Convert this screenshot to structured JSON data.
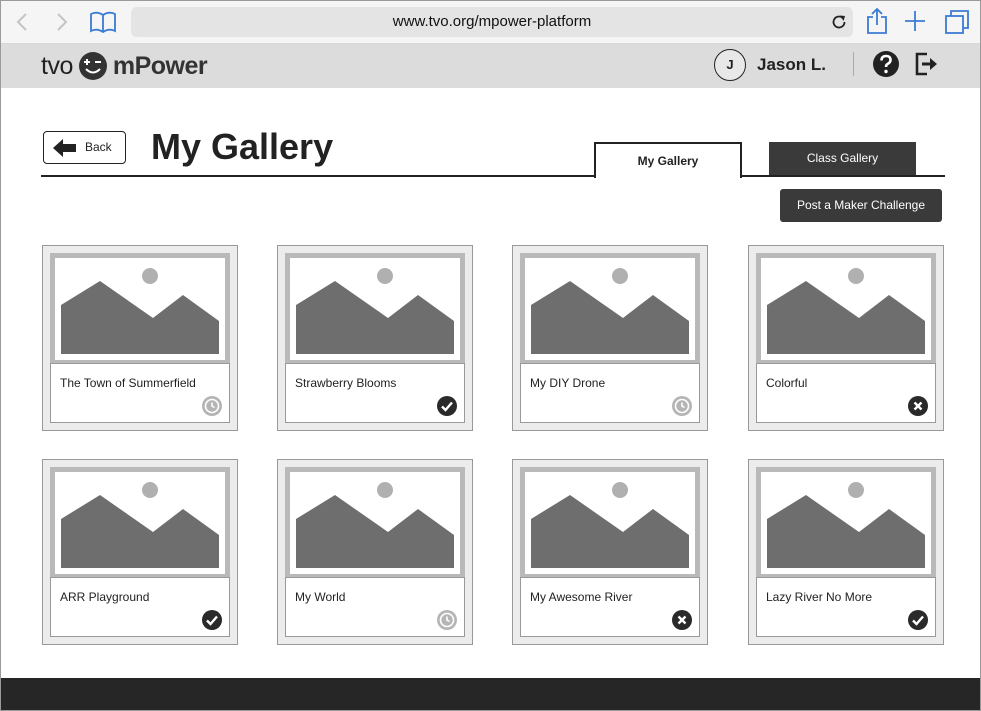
{
  "browser": {
    "url": "www.tvo.org/mpower-platform"
  },
  "header": {
    "logo_left": "tvo",
    "logo_right": "mPower",
    "avatar_initial": "J",
    "user_name": "Jason L."
  },
  "page": {
    "back_label": "Back",
    "title": "My Gallery",
    "tabs": [
      {
        "label": "My Gallery",
        "active": true
      },
      {
        "label": "Class Gallery",
        "active": false
      }
    ],
    "post_button_label": "Post a Maker Challenge"
  },
  "gallery": [
    {
      "title": "The Town of Summerfield",
      "status": "pending"
    },
    {
      "title": "Strawberry Blooms",
      "status": "approved"
    },
    {
      "title": "My DIY Drone",
      "status": "pending"
    },
    {
      "title": "Colorful",
      "status": "rejected"
    },
    {
      "title": "ARR Playground",
      "status": "approved"
    },
    {
      "title": "My World",
      "status": "pending"
    },
    {
      "title": "My Awesome River",
      "status": "rejected"
    },
    {
      "title": "Lazy River No More",
      "status": "approved"
    }
  ],
  "icons": {
    "pending": "clock-icon",
    "approved": "checkmark-icon",
    "rejected": "x-icon"
  },
  "colors": {
    "dark": "#3a3a3a",
    "header_bg": "#dcdcdc",
    "placeholder_fill": "#6e6e6e"
  }
}
